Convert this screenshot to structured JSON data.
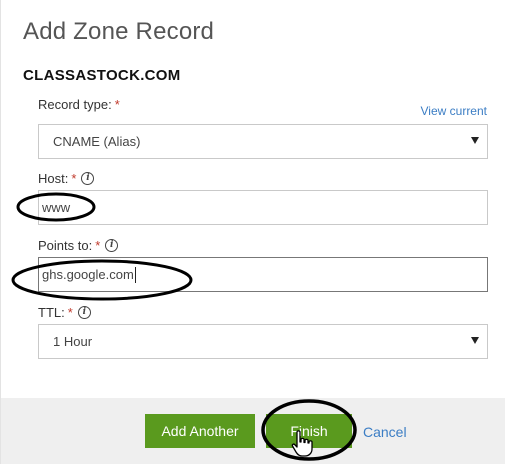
{
  "dialog": {
    "title": "Add Zone Record",
    "domain": "CLASSASTOCK.COM"
  },
  "record_type": {
    "label": "Record type:",
    "required_mark": "*",
    "view_current_link": "View current",
    "selected_value": "CNAME (Alias)"
  },
  "host": {
    "label": "Host:",
    "required_mark": "*",
    "info_icon": "info-icon",
    "value": "www"
  },
  "points_to": {
    "label": "Points to:",
    "required_mark": "*",
    "info_icon": "info-icon",
    "value": "ghs.google.com"
  },
  "ttl": {
    "label": "TTL:",
    "required_mark": "*",
    "info_icon": "info-icon",
    "selected_value": "1 Hour"
  },
  "footer": {
    "add_another_label": "Add Another",
    "finish_label": "Finish",
    "cancel_label": "Cancel"
  },
  "colors": {
    "button_green": "#5a9a1e",
    "link_blue": "#3b7dc4",
    "required_red": "#c0392b"
  }
}
